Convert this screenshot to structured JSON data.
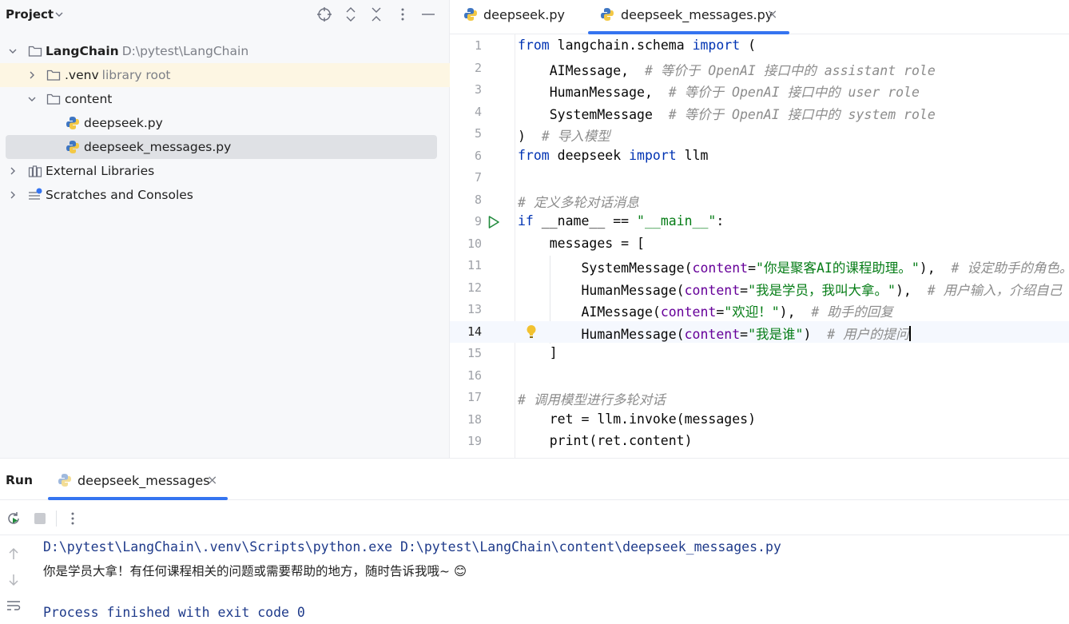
{
  "project": {
    "title": "Project",
    "tree": [
      {
        "label": "LangChain",
        "hint": "D:\\pytest\\LangChain",
        "icon": "folder-icon",
        "bold": true
      },
      {
        "label": ".venv",
        "hint": "library root",
        "icon": "folder-icon"
      },
      {
        "label": "content",
        "hint": "",
        "icon": "folder-icon"
      },
      {
        "label": "deepseek.py",
        "hint": "",
        "icon": "python-file-icon"
      },
      {
        "label": "deepseek_messages.py",
        "hint": "",
        "icon": "python-file-icon"
      },
      {
        "label": "External Libraries",
        "hint": "",
        "icon": "library-icon"
      },
      {
        "label": "Scratches and Consoles",
        "hint": "",
        "icon": "scratches-icon"
      }
    ]
  },
  "editor": {
    "tabs": [
      {
        "label": "deepseek.py",
        "active": false
      },
      {
        "label": "deepseek_messages.py",
        "active": true
      }
    ],
    "close_glyph": "×",
    "line_numbers": [
      "1",
      "2",
      "3",
      "4",
      "5",
      "6",
      "7",
      "8",
      "9",
      "10",
      "11",
      "12",
      "13",
      "14",
      "15",
      "16",
      "17",
      "18",
      "19"
    ],
    "lines": [
      {
        "kw1": "from",
        "t1": " langchain.schema ",
        "kw2": "import",
        "t2": " ("
      },
      {
        "t1": "    AIMessage,  ",
        "cm": "# 等价于 OpenAI 接口中的 assistant role"
      },
      {
        "t1": "    HumanMessage,  ",
        "cm": "# 等价于 OpenAI 接口中的 user role"
      },
      {
        "t1": "    SystemMessage  ",
        "cm": "# 等价于 OpenAI 接口中的 system role"
      },
      {
        "t1": ")  ",
        "cm": "# 导入模型"
      },
      {
        "kw1": "from",
        "t1": " deepseek ",
        "kw2": "import",
        "t2": " llm"
      },
      {},
      {
        "cm": "# 定义多轮对话消息"
      },
      {
        "kw1": "if",
        "t1": " __name__ == ",
        "st": "\"__main__\"",
        "t2": ":"
      },
      {
        "t1": "    messages = ["
      },
      {
        "t1": "        SystemMessage(",
        "pm": "content",
        "eq": "=",
        "st": "\"你是聚客AI的课程助理。\"",
        "t2": "),  ",
        "cm": "# 设定助手的角色。"
      },
      {
        "t1": "        HumanMessage(",
        "pm": "content",
        "eq": "=",
        "st": "\"我是学员，我叫大拿。\"",
        "t2": "),  ",
        "cm": "# 用户输入，介绍自己"
      },
      {
        "t1": "        AIMessage(",
        "pm": "content",
        "eq": "=",
        "st": "\"欢迎！\"",
        "t2": "),  ",
        "cm": "# 助手的回复"
      },
      {
        "t1": "        HumanMessage(",
        "pm": "content",
        "eq": "=",
        "st": "\"我是谁\"",
        "t2": ")  ",
        "cm": "# 用户的提问"
      },
      {
        "t1": "    ]"
      },
      {},
      {
        "cm": "# 调用模型进行多轮对话"
      },
      {
        "t1": "    ret = llm.invoke(messages)"
      },
      {
        "t1": "    print(ret.content)"
      }
    ]
  },
  "run": {
    "title": "Run",
    "tab_label": "deepseek_messages",
    "close_glyph": "×",
    "console": [
      "D:\\pytest\\LangChain\\.venv\\Scripts\\python.exe D:\\pytest\\LangChain\\content\\deepseek_messages.py",
      "你是学员大拿！有任何课程相关的问题或需要帮助的地方，随时告诉我哦~ 😊",
      "Process finished with exit code 0"
    ]
  },
  "colors": {
    "accent": "#3574f0",
    "keyword": "#0033b3",
    "string": "#067d17",
    "comment": "#8c8c8c",
    "param": "#660099"
  }
}
